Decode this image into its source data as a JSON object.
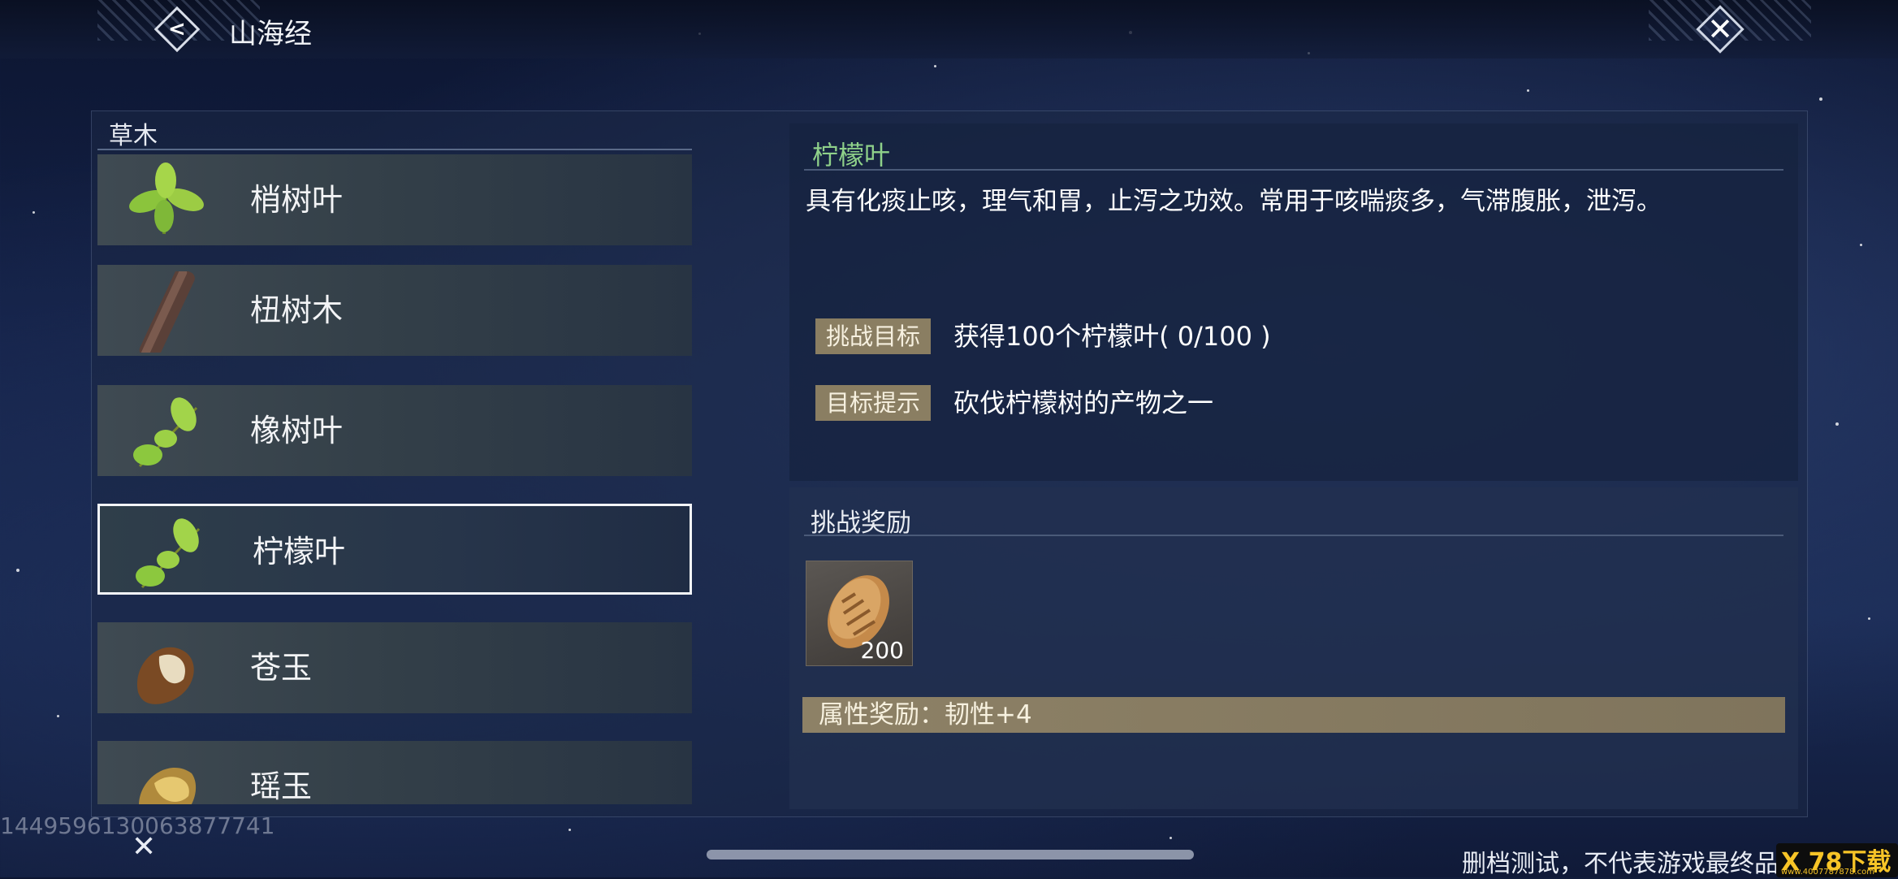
{
  "header": {
    "title": "山海经"
  },
  "category": {
    "label": "草木"
  },
  "items": [
    {
      "name": "梢树叶"
    },
    {
      "name": "杻树木"
    },
    {
      "name": "橡树叶"
    },
    {
      "name": "柠檬叶",
      "selected": true
    },
    {
      "name": "苍玉"
    },
    {
      "name": "瑶玉"
    }
  ],
  "detail": {
    "title": "柠檬叶",
    "description": "具有化痰止咳，理气和胃，止泻之功效。常用于咳喘痰多，气滞腹胀，泄泻。",
    "goal_label": "挑战目标",
    "goal_text": "获得100个柠檬叶( 0/100 )",
    "hint_label": "目标提示",
    "hint_text": "砍伐柠檬树的产物之一"
  },
  "reward": {
    "title": "挑战奖励",
    "item_quantity": "200",
    "attribute_text": "属性奖励：韧性+4"
  },
  "footer": {
    "uid": "1449596130063877741",
    "notice": "删档测试，不代表游戏最终品质",
    "logo_main": "X 78下载",
    "logo_sub": "www.4007787878.com"
  }
}
